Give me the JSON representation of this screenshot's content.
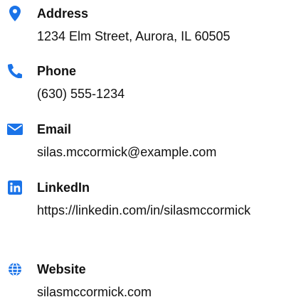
{
  "accent_color": "#1a73e8",
  "contacts": [
    {
      "icon": "location-pin-icon",
      "label": "Address",
      "value": "1234 Elm Street, Aurora, IL 60505"
    },
    {
      "icon": "phone-icon",
      "label": "Phone",
      "value": "(630) 555-1234"
    },
    {
      "icon": "envelope-icon",
      "label": "Email",
      "value": "silas.mccormick@example.com"
    },
    {
      "icon": "linkedin-icon",
      "label": "LinkedIn",
      "value": "https://linkedin.com/in/silasmccormick"
    },
    {
      "icon": "globe-icon",
      "label": "Website",
      "value": "silasmccormick.com"
    }
  ]
}
